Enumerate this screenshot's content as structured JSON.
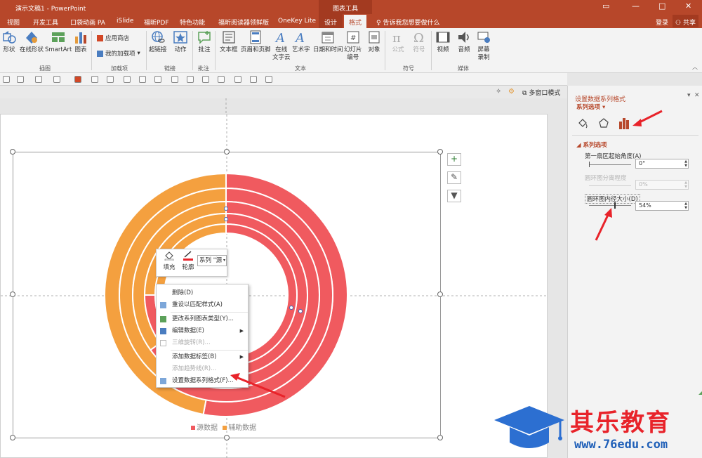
{
  "window": {
    "title": "演示文稿1 - PowerPoint",
    "context_tab_group": "图表工具"
  },
  "menubar": {
    "tabs": [
      "视图",
      "开发工具",
      "口袋动画 PA",
      "iSlide",
      "福昕PDF",
      "特色功能",
      "福昕阅读器领鲜版",
      "OneKey Lite",
      "设计",
      "格式"
    ],
    "tell_me": "告诉我您想要做什么",
    "login": "登录",
    "share": "共享"
  },
  "ribbon": {
    "buttons": [
      {
        "label": "形状"
      },
      {
        "label": "在线形状"
      },
      {
        "label": "SmartArt"
      },
      {
        "label": "图表"
      },
      {
        "label": "超链接"
      },
      {
        "label": "动作"
      },
      {
        "label": "批注"
      },
      {
        "label": "文本框"
      },
      {
        "label": "页眉和页脚"
      },
      {
        "label": "在线\n文字云"
      },
      {
        "label": "艺术字"
      },
      {
        "label": "日期和时间"
      },
      {
        "label": "幻灯片\n编号"
      },
      {
        "label": "对象"
      },
      {
        "label": "公式"
      },
      {
        "label": "符号"
      },
      {
        "label": "视频"
      },
      {
        "label": "音频"
      },
      {
        "label": "屏幕\n录制"
      }
    ],
    "addins": [
      "应用商店",
      "我的加载项"
    ],
    "groups": [
      "插图",
      "加载项",
      "链接",
      "批注",
      "文本",
      "符号",
      "媒体"
    ]
  },
  "view_toolbar": {
    "multi_window": "多窗口模式"
  },
  "chart": {
    "legend": [
      "源数据",
      "辅助数据"
    ],
    "colors": {
      "source": "#f05a5f",
      "helper": "#f4a03f"
    }
  },
  "mini_toolbar": {
    "fill": "填充",
    "outline": "轮廓",
    "series": "系列 \"源"
  },
  "context_menu": {
    "items": [
      {
        "label": "删除(D)",
        "disabled": false
      },
      {
        "label": "重设以匹配样式(A)",
        "disabled": false
      },
      {
        "label": "更改系列图表类型(Y)...",
        "disabled": false
      },
      {
        "label": "编辑数据(E)",
        "disabled": false,
        "submenu": true
      },
      {
        "label": "三维旋转(R)...",
        "disabled": true
      },
      {
        "label": "添加数据标签(B)",
        "disabled": false,
        "submenu": true
      },
      {
        "label": "添加趋势线(R)...",
        "disabled": true
      },
      {
        "label": "设置数据系列格式(F)...",
        "disabled": false
      }
    ]
  },
  "format_pane": {
    "title": "设置数据系列格式",
    "subtitle": "系列选项",
    "section": "系列选项",
    "first_slice_angle_label": "第一扇区起始角度(A)",
    "first_slice_angle_value": "0°",
    "explosion_label": "圆环图分离程度",
    "explosion_value": "0%",
    "hole_size_label": "圆环图内径大小(D)",
    "hole_size_value": "54%"
  },
  "watermark": {
    "brand": "其乐教育",
    "url": "www.76edu.com"
  }
}
